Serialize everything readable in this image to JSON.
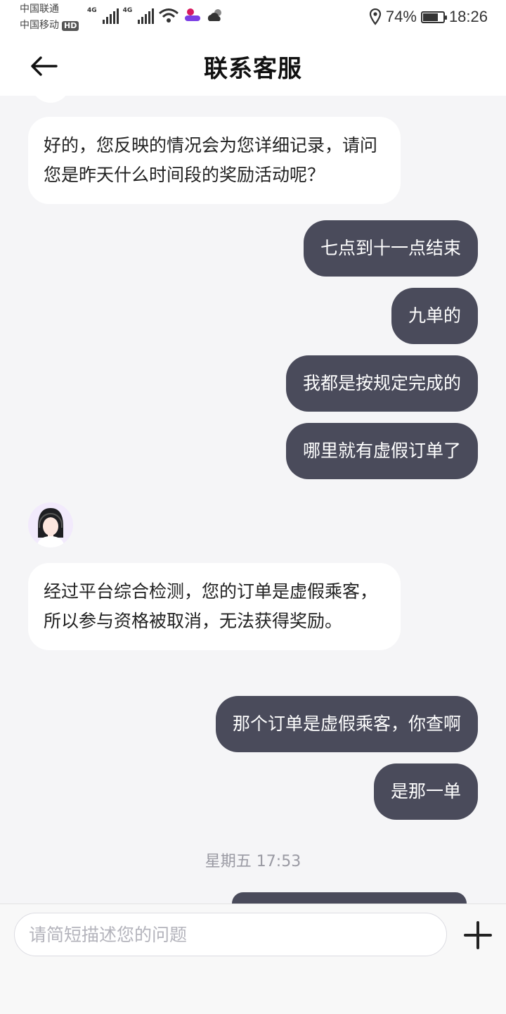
{
  "status_bar": {
    "carrier_1": "中国联通",
    "carrier_2": "中国移动",
    "carrier_2_badge": "HD",
    "network_1": "4G",
    "network_2": "4G",
    "battery_percent": "74%",
    "battery_level": 0.74,
    "time": "18:26"
  },
  "header": {
    "title": "联系客服"
  },
  "messages": [
    {
      "role": "agent",
      "text": "好的，您反映的情况会为您详细记录，请问您是昨天什么时间段的奖励活动呢？"
    },
    {
      "role": "user",
      "text": "七点到十一点结束"
    },
    {
      "role": "user",
      "text": "九单的"
    },
    {
      "role": "user",
      "text": "我都是按规定完成的"
    },
    {
      "role": "user",
      "text": "哪里就有虚假订单了"
    },
    {
      "role": "agent",
      "text": "经过平台综合检测，您的订单是虚假乘客，所以参与资格被取消，无法获得奖励。"
    },
    {
      "role": "user",
      "text": "那个订单是虚假乘客，你查啊"
    },
    {
      "role": "user",
      "text": "是那一单"
    }
  ],
  "timestamp": "星期五 17:53",
  "input": {
    "placeholder": "请简短描述您的问题",
    "value": ""
  },
  "icons": {
    "back": "arrow-left-icon",
    "add": "plus-icon",
    "location": "location-pin-icon",
    "wifi": "wifi-icon",
    "weather": "cloud-icon",
    "battery": "battery-icon"
  }
}
